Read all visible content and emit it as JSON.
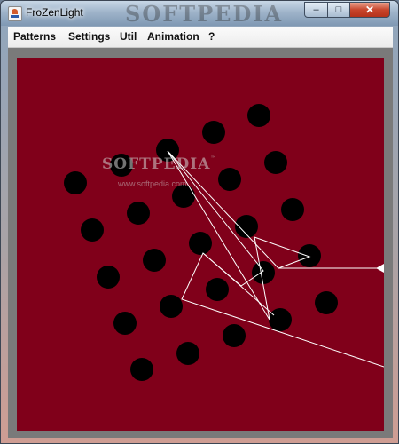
{
  "window": {
    "title": "FroZenLight",
    "watermark": "SOFTPEDIA",
    "controls": {
      "minimize": "–",
      "maximize": "□",
      "close": "✕"
    }
  },
  "menu": [
    "Patterns",
    "Settings",
    "Util",
    "Animation",
    "?"
  ],
  "canvas": {
    "background": "#80001a",
    "border": "#7a7a7a",
    "watermark_text": "SOFTPEDIA",
    "watermark_tm": "™",
    "watermark_url": "www.softpedia.com"
  },
  "colors": {
    "dot": "#000000",
    "beam": "#ffffff"
  },
  "icons": {
    "app": "java-cup-icon"
  }
}
